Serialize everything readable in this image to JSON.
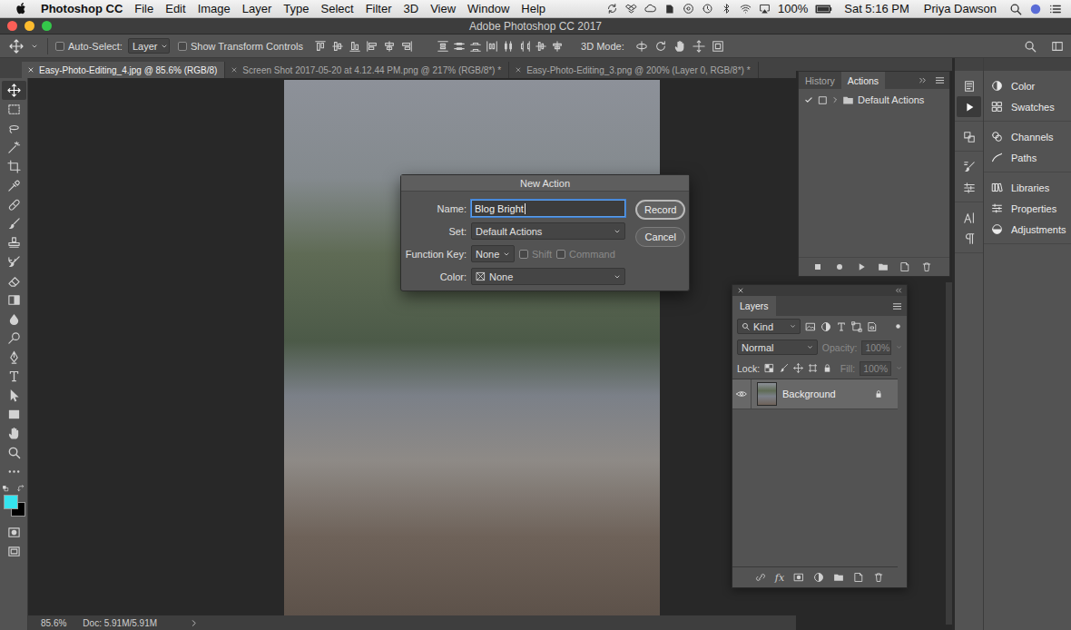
{
  "menubar": {
    "app": "Photoshop CC",
    "menus": [
      "File",
      "Edit",
      "Image",
      "Layer",
      "Type",
      "Select",
      "Filter",
      "3D",
      "View",
      "Window",
      "Help"
    ],
    "battery": "100%",
    "clock": "Sat 5:16 PM",
    "user": "Priya Dawson"
  },
  "window": {
    "title": "Adobe Photoshop CC 2017"
  },
  "options_bar": {
    "auto_select": {
      "label": "Auto-Select:",
      "checked": false
    },
    "target": "Layer",
    "transform_controls": {
      "label": "Show Transform Controls",
      "checked": false
    },
    "mode_3d": "3D Mode:"
  },
  "tabs": [
    {
      "label": "Easy-Photo-Editing_4.jpg @ 85.6% (RGB/8)",
      "selected": true
    },
    {
      "label": "Screen Shot 2017-05-20 at 4.12.44 PM.png @ 217% (RGB/8*) *",
      "selected": false
    },
    {
      "label": "Easy-Photo-Editing_3.png @ 200% (Layer 0, RGB/8*) *",
      "selected": false
    }
  ],
  "tools": [
    {
      "selected": true
    },
    {
      "selected": false
    },
    {
      "selected": false
    },
    {
      "selected": false
    },
    {
      "selected": false
    },
    {
      "selected": false
    },
    {
      "selected": false
    },
    {
      "selected": false
    },
    {
      "selected": false
    },
    {
      "selected": false
    },
    {
      "selected": false
    },
    {
      "selected": false
    },
    {
      "selected": false
    },
    {
      "selected": false
    },
    {
      "selected": false
    },
    {
      "selected": false
    },
    {
      "selected": false
    },
    {
      "selected": false
    },
    {
      "selected": false
    },
    {
      "selected": false
    },
    {
      "selected": false
    }
  ],
  "colors": {
    "foreground": "#35e4ef",
    "background": "#000000"
  },
  "dialog": {
    "title": "New Action",
    "name": {
      "label": "Name:",
      "value": "Blog Bright",
      "focused": true
    },
    "set": {
      "label": "Set:",
      "value": "Default Actions"
    },
    "function_key": {
      "label": "Function Key:",
      "value": "None"
    },
    "modifiers": [
      {
        "label": "Shift",
        "checked": false,
        "disabled": true
      },
      {
        "label": "Command",
        "checked": false,
        "disabled": true
      }
    ],
    "color": {
      "label": "Color:",
      "value": "None"
    },
    "buttons": [
      {
        "label": "Record",
        "default": true
      },
      {
        "label": "Cancel",
        "default": false
      }
    ]
  },
  "actions_panel": {
    "tabs": [
      {
        "label": "History",
        "selected": false
      },
      {
        "label": "Actions",
        "selected": true
      }
    ],
    "items": [
      {
        "label": "Default Actions",
        "checked": true,
        "expanded": false
      }
    ]
  },
  "layers_panel": {
    "title": "Layers",
    "filter": "Kind",
    "blend_mode": "Normal",
    "opacity": {
      "label": "Opacity:",
      "value": "100%",
      "disabled": true
    },
    "lock_label": "Lock:",
    "fill": {
      "label": "Fill:",
      "value": "100%",
      "disabled": true
    },
    "layers": [
      {
        "name": "Background",
        "visible": true,
        "locked": true,
        "selected": true
      }
    ],
    "fx_label": "fx"
  },
  "dock_strip": [
    {
      "selected": false
    },
    {
      "selected": true
    },
    {
      "selected": false
    },
    {
      "selected": false
    },
    {
      "selected": false
    },
    {
      "selected": false
    },
    {
      "selected": false
    }
  ],
  "dock_panels": [
    {
      "items": [
        "Color",
        "Swatches"
      ]
    },
    {
      "items": [
        "Channels",
        "Paths"
      ]
    },
    {
      "items": [
        "Libraries",
        "Properties",
        "Adjustments"
      ]
    }
  ],
  "status_bar": {
    "zoom": "85.6%",
    "doc": "Doc: 5.91M/5.91M"
  }
}
